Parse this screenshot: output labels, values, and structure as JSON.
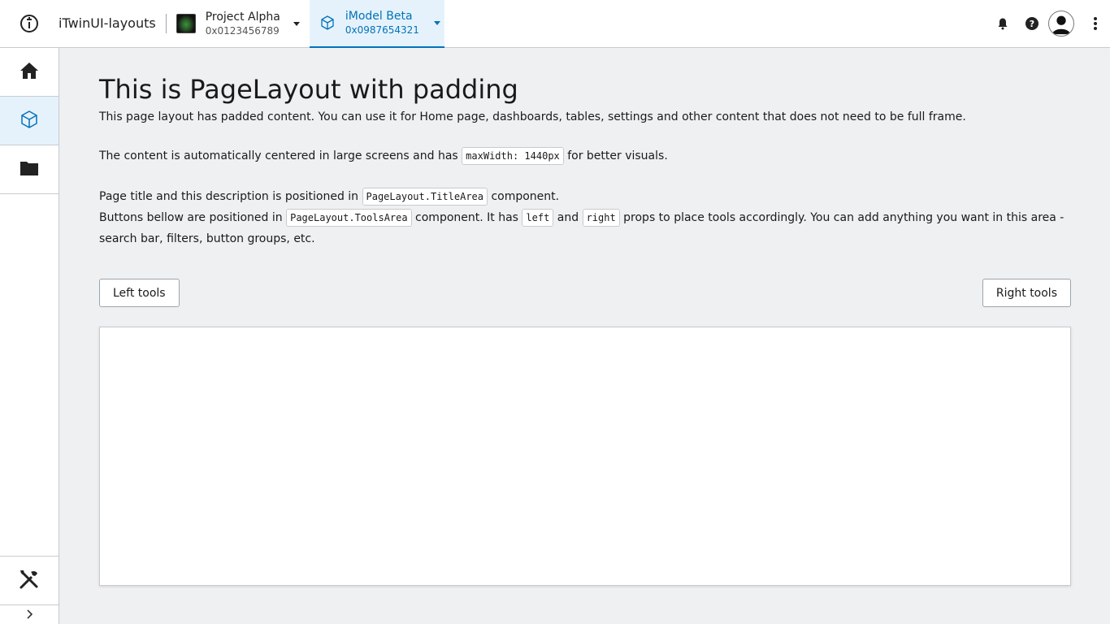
{
  "header": {
    "app_title": "iTwinUI-layouts",
    "project": {
      "title": "Project Alpha",
      "id": "0x0123456789"
    },
    "imodel": {
      "title": "iModel Beta",
      "id": "0x0987654321"
    },
    "icons": [
      "itwin-logo-icon",
      "bell-icon",
      "help-icon",
      "user-avatar-icon",
      "more-vertical-icon"
    ]
  },
  "sidebar": {
    "items": [
      {
        "icon": "home-icon"
      },
      {
        "icon": "cube-icon",
        "active": true
      },
      {
        "icon": "folder-icon"
      }
    ],
    "bottom_items": [
      {
        "icon": "tools-icon"
      }
    ],
    "expander_icon": "chevron-right-icon"
  },
  "main": {
    "title": "This is PageLayout with padding",
    "p1": "This page layout has padded content. You can use it for Home page, dashboards, tables, settings and other content that does not need to be full frame.",
    "p2_pre": "The content is automatically centered in large screens and has ",
    "p2_code": "maxWidth: 1440px",
    "p2_post": " for better visuals.",
    "p3_pre": "Page title and this description is positioned in ",
    "p3_code": "PageLayout.TitleArea",
    "p3_post": " component.",
    "p4_pre": "Buttons bellow are positioned in ",
    "p4_code1": "PageLayout.ToolsArea",
    "p4_mid1": " component. It has ",
    "p4_code2": "left",
    "p4_mid2": " and ",
    "p4_code3": "right",
    "p4_post": " props to place tools accordingly. You can add anything you want in this area - search bar, filters, button groups, etc.",
    "left_tools_label": "Left tools",
    "right_tools_label": "Right tools"
  },
  "colors": {
    "accent": "#0073ba",
    "active_bg": "#e6f2fb",
    "page_bg": "#eef0f1",
    "border": "#c7ccd1"
  }
}
